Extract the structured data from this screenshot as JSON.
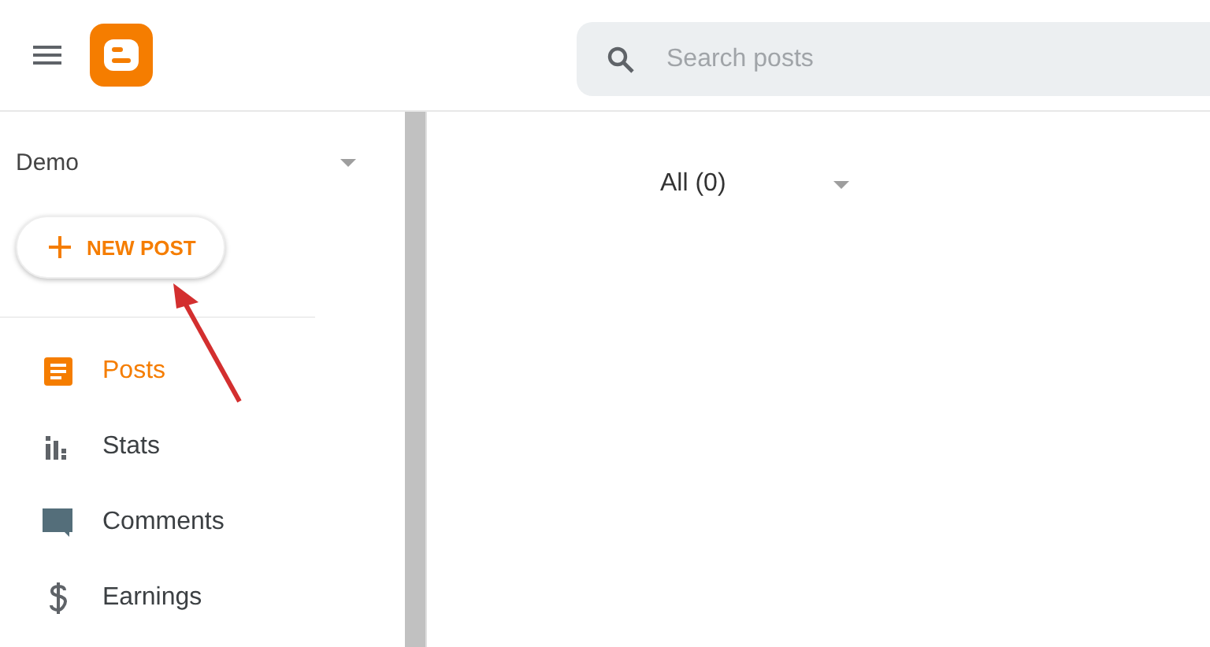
{
  "header": {
    "search": {
      "placeholder": "Search posts"
    }
  },
  "sidebar": {
    "blog_name": "Demo",
    "new_post_button": "NEW POST",
    "items": [
      {
        "label": "Posts",
        "selected": true
      },
      {
        "label": "Stats",
        "selected": false
      },
      {
        "label": "Comments",
        "selected": false
      },
      {
        "label": "Earnings",
        "selected": false
      }
    ]
  },
  "main": {
    "filter": "All (0)"
  }
}
